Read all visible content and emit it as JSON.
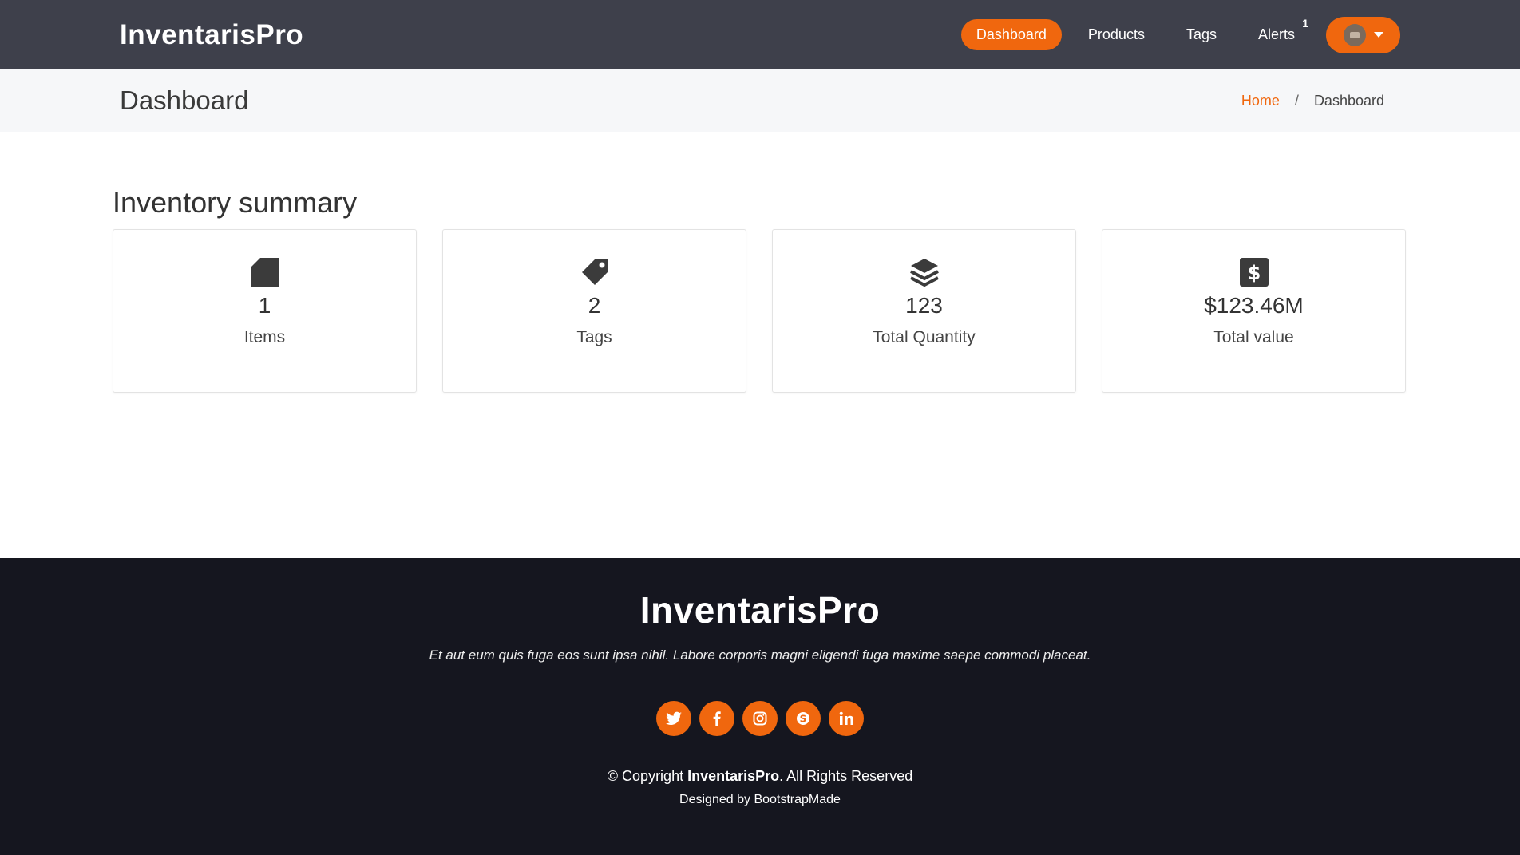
{
  "header": {
    "brand": "InventarisPro",
    "nav": [
      {
        "label": "Dashboard",
        "active": true
      },
      {
        "label": "Products"
      },
      {
        "label": "Tags"
      },
      {
        "label": "Alerts",
        "badge": "1"
      }
    ]
  },
  "pagebar": {
    "title": "Dashboard",
    "breadcrumb_home": "Home",
    "breadcrumb_sep": "/",
    "breadcrumb_current": "Dashboard"
  },
  "summary": {
    "title": "Inventory summary",
    "cards": [
      {
        "icon": "file-icon",
        "value": "1",
        "label": "Items"
      },
      {
        "icon": "tag-icon",
        "value": "2",
        "label": "Tags"
      },
      {
        "icon": "layers-icon",
        "value": "123",
        "label": "Total Quantity"
      },
      {
        "icon": "dollar-icon",
        "value": "$123.46M",
        "label": "Total value"
      }
    ]
  },
  "footer": {
    "brand": "InventarisPro",
    "text": "Et aut eum quis fuga eos sunt ipsa nihil. Labore corporis magni eligendi fuga maxime saepe commodi placeat.",
    "socials": [
      "twitter-icon",
      "facebook-icon",
      "instagram-icon",
      "skype-icon",
      "linkedin-icon"
    ],
    "copyright_prefix": "© Copyright ",
    "copyright_brand": "InventarisPro",
    "copyright_suffix": ". All Rights Reserved",
    "credits": "Designed by BootstrapMade"
  },
  "colors": {
    "accent": "#f0670e",
    "header_bg": "#3e404b",
    "footer_bg": "#15161f"
  }
}
